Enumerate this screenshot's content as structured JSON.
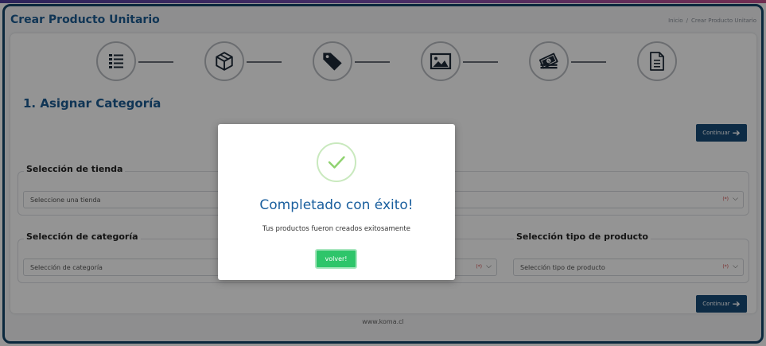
{
  "header": {
    "title": "Crear Producto Unitario",
    "breadcrumb": {
      "home": "Inicio",
      "separator": "/",
      "current": "Crear Producto Unitario"
    }
  },
  "steps": [
    {
      "icon": "list-icon"
    },
    {
      "icon": "box-icon"
    },
    {
      "icon": "tag-icon"
    },
    {
      "icon": "image-icon"
    },
    {
      "icon": "money-icon"
    },
    {
      "icon": "document-icon"
    }
  ],
  "section": {
    "title": "1. Asignar Categoría"
  },
  "buttons": {
    "continue_label": "Continuar"
  },
  "store_section": {
    "legend": "Selección de tienda",
    "placeholder": "Seleccione una tienda",
    "required_mark": "(*)"
  },
  "category_section": {
    "legend": "Selección de categoría",
    "placeholder": "Selección de categoría",
    "required_mark": "(*)"
  },
  "product_type_section": {
    "legend": "Selección tipo de producto",
    "placeholder": "Selección tipo de producto",
    "required_mark": "(*)"
  },
  "footer": {
    "text": "www.koma.cl"
  },
  "modal": {
    "title": "Completado con éxito!",
    "message": "Tus productos fueron creados exitosamente",
    "button_label": "volver!"
  },
  "colors": {
    "primary": "#174a78",
    "title_blue": "#1d5c93",
    "success_green": "#2ec56a",
    "required_red": "#d34a4a"
  }
}
